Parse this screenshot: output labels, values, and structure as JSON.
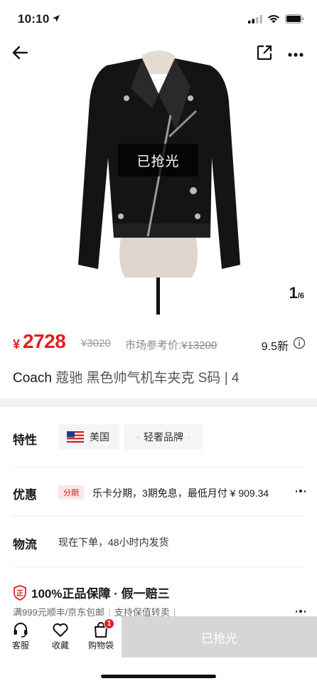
{
  "status_bar": {
    "time": "10:10"
  },
  "gallery": {
    "overlay_label": "已抢光",
    "current_index": "1",
    "total_label": "/6"
  },
  "price": {
    "currency": "¥",
    "current": "2728",
    "original": "¥3020",
    "market_label": "市场参考价:",
    "market_value": "¥13200",
    "condition": "9.5新"
  },
  "title": {
    "brand": "Coach",
    "rest": " 蔻驰 黑色帅气机车夹克 S码 | 4"
  },
  "attributes": {
    "label": "特性",
    "chips": [
      "美国",
      "轻奢品牌"
    ]
  },
  "promotion": {
    "label": "优惠",
    "tag": "分期",
    "text": "乐卡分期，3期免息，最低月付 ¥ 909.34"
  },
  "shipping": {
    "label": "物流",
    "text": "现在下单，48小时内发货"
  },
  "guarantee": {
    "title": "100%正品保障 · 假一赔三",
    "sub_1": "满999元顺丰/京东包邮",
    "sub_2": "支持保值转卖"
  },
  "bottom_bar": {
    "service_label": "客服",
    "favorite_label": "收藏",
    "cart_label": "购物袋",
    "cart_count": "1",
    "buy_label": "已抢光"
  },
  "colors": {
    "accent_red": "#e02020",
    "disabled_button": "#d6d6d6"
  }
}
